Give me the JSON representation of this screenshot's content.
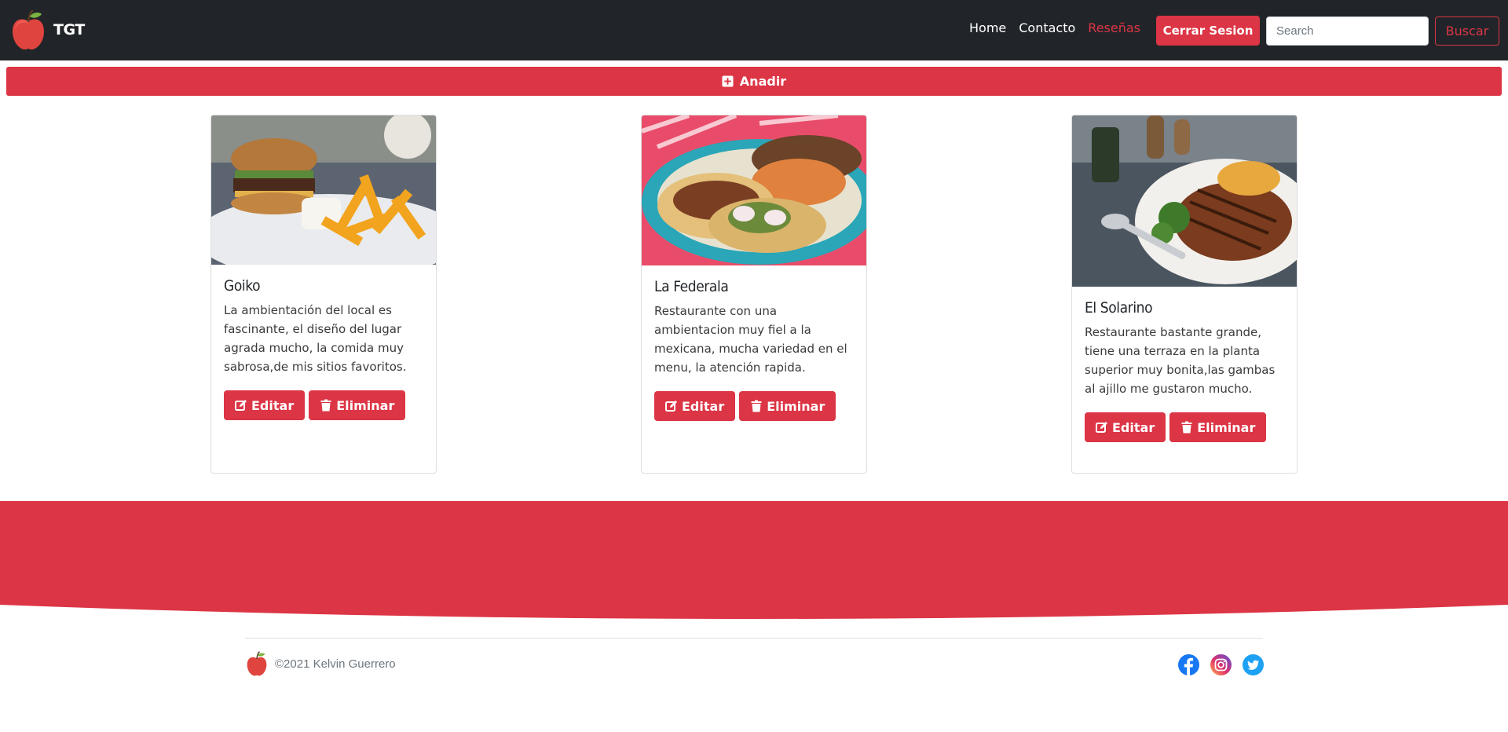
{
  "brand": {
    "name": "TGT",
    "logo_icon": "apple-icon"
  },
  "nav": {
    "links": [
      {
        "label": "Home",
        "active": false
      },
      {
        "label": "Contacto",
        "active": false
      },
      {
        "label": "Reseñas",
        "active": true
      }
    ],
    "logout_label": "Cerrar Sesion",
    "search_placeholder": "Search",
    "search_button_label": "Buscar"
  },
  "add_bar": {
    "label": "Anadir",
    "icon": "plus-square-icon"
  },
  "cards": [
    {
      "title": "Goiko",
      "image": "burger-and-fries-photo",
      "text": "La ambientación del local es fascinante, el diseño del lugar agrada mucho, la comida muy sabrosa,de mis sitios favoritos.",
      "edit_label": "Editar",
      "delete_label": "Eliminar"
    },
    {
      "title": "La Federala",
      "image": "tacos-plate-photo",
      "text": "Restaurante con una ambientacion muy fiel a la mexicana, mucha variedad en el menu, la atención rapida.",
      "edit_label": "Editar",
      "delete_label": "Eliminar"
    },
    {
      "title": "El Solarino",
      "image": "grilled-meat-plate-photo",
      "text": "Restaurante bastante grande, tiene una terraza en la planta superior muy bonita,las gambas al ajillo me gustaron mucho.",
      "edit_label": "Editar",
      "delete_label": "Eliminar"
    }
  ],
  "footer": {
    "copyright": "©2021 Kelvin Guerrero",
    "social": [
      "facebook-icon",
      "instagram-icon",
      "twitter-icon"
    ]
  },
  "colors": {
    "accent": "#dc3545",
    "navbar": "#212529"
  }
}
